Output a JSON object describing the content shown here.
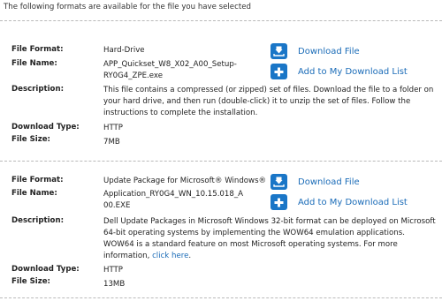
{
  "intro": "The following formats are available for the file you have selected",
  "labels": {
    "format": "File Format:",
    "name": "File Name:",
    "description": "Description:",
    "download_type": "Download Type:",
    "size": "File Size:"
  },
  "actions": {
    "download": "Download File",
    "add": "Add to My Download List"
  },
  "files": [
    {
      "format": "Hard-Drive",
      "name_lines": [
        "APP_Quickset_W8_X02_A00_Setup-",
        "RY0G4_ZPE.exe"
      ],
      "description": "This file contains a compressed (or zipped) set of files. Download the file to a folder on your hard drive, and then run (double-click) it to unzip the set of files. Follow the instructions to complete the installation.",
      "download_type": "HTTP",
      "size": "7MB"
    },
    {
      "format": "Update Package for Microsoft® Windows®",
      "name_lines": [
        "Application_RY0G4_WN_10.15.018_A",
        "00.EXE"
      ],
      "description": "Dell Update Packages in Microsoft Windows 32-bit format can be deployed on Microsoft 64-bit operating systems by implementing the WOW64 emulation applications. WOW64 is a standard feature on most Microsoft operating systems. For more information,",
      "description_link": "click here",
      "description_end": ".",
      "download_type": "HTTP",
      "size": "13MB"
    }
  ],
  "colors": {
    "accent": "#1a76c7",
    "link": "#1b6cb8"
  },
  "icons": {
    "download": "download-icon",
    "add": "plus-icon"
  }
}
